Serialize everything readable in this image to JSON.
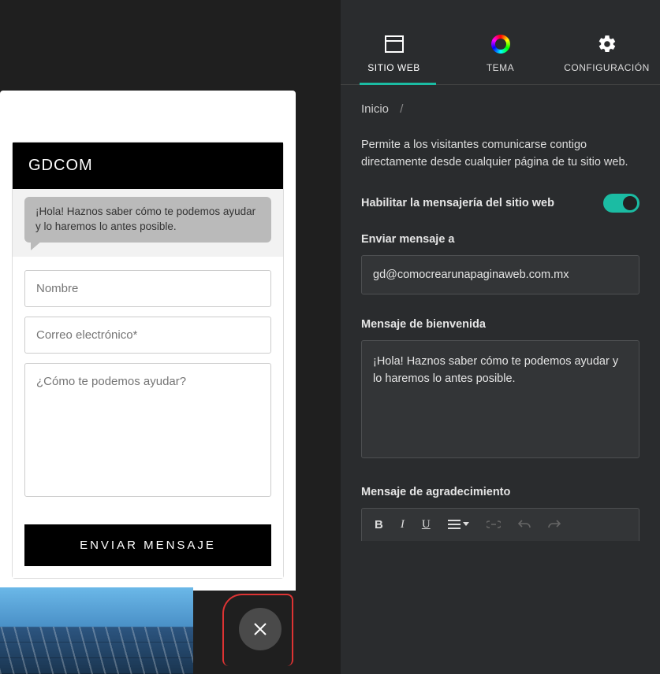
{
  "preview": {
    "chat_title": "GDCOM",
    "welcome_text": "¡Hola! Haznos saber cómo te podemos ayudar y lo haremos lo antes posible.",
    "name_placeholder": "Nombre",
    "email_placeholder": "Correo electrónico*",
    "help_placeholder": "¿Cómo te podemos ayudar?",
    "send_button": "ENVIAR MENSAJE"
  },
  "panel": {
    "tabs": {
      "website": "SITIO WEB",
      "theme": "TEMA",
      "config": "CONFIGURACIÓN"
    },
    "breadcrumb": "Inicio",
    "description": "Permite a los visitantes comunicarse contigo directamente desde cualquier página de tu sitio web.",
    "toggle_label": "Habilitar la mensajería del sitio web",
    "send_to_label": "Enviar mensaje a",
    "send_to_value": "gd@comocrearunapaginaweb.com.mx",
    "welcome_label": "Mensaje de bienvenida",
    "welcome_value": "¡Hola! Haznos saber cómo te podemos ayudar y lo haremos lo antes posible.",
    "thanks_label": "Mensaje de agradecimiento",
    "rte": {
      "bold": "B",
      "italic": "I",
      "underline": "U"
    }
  }
}
